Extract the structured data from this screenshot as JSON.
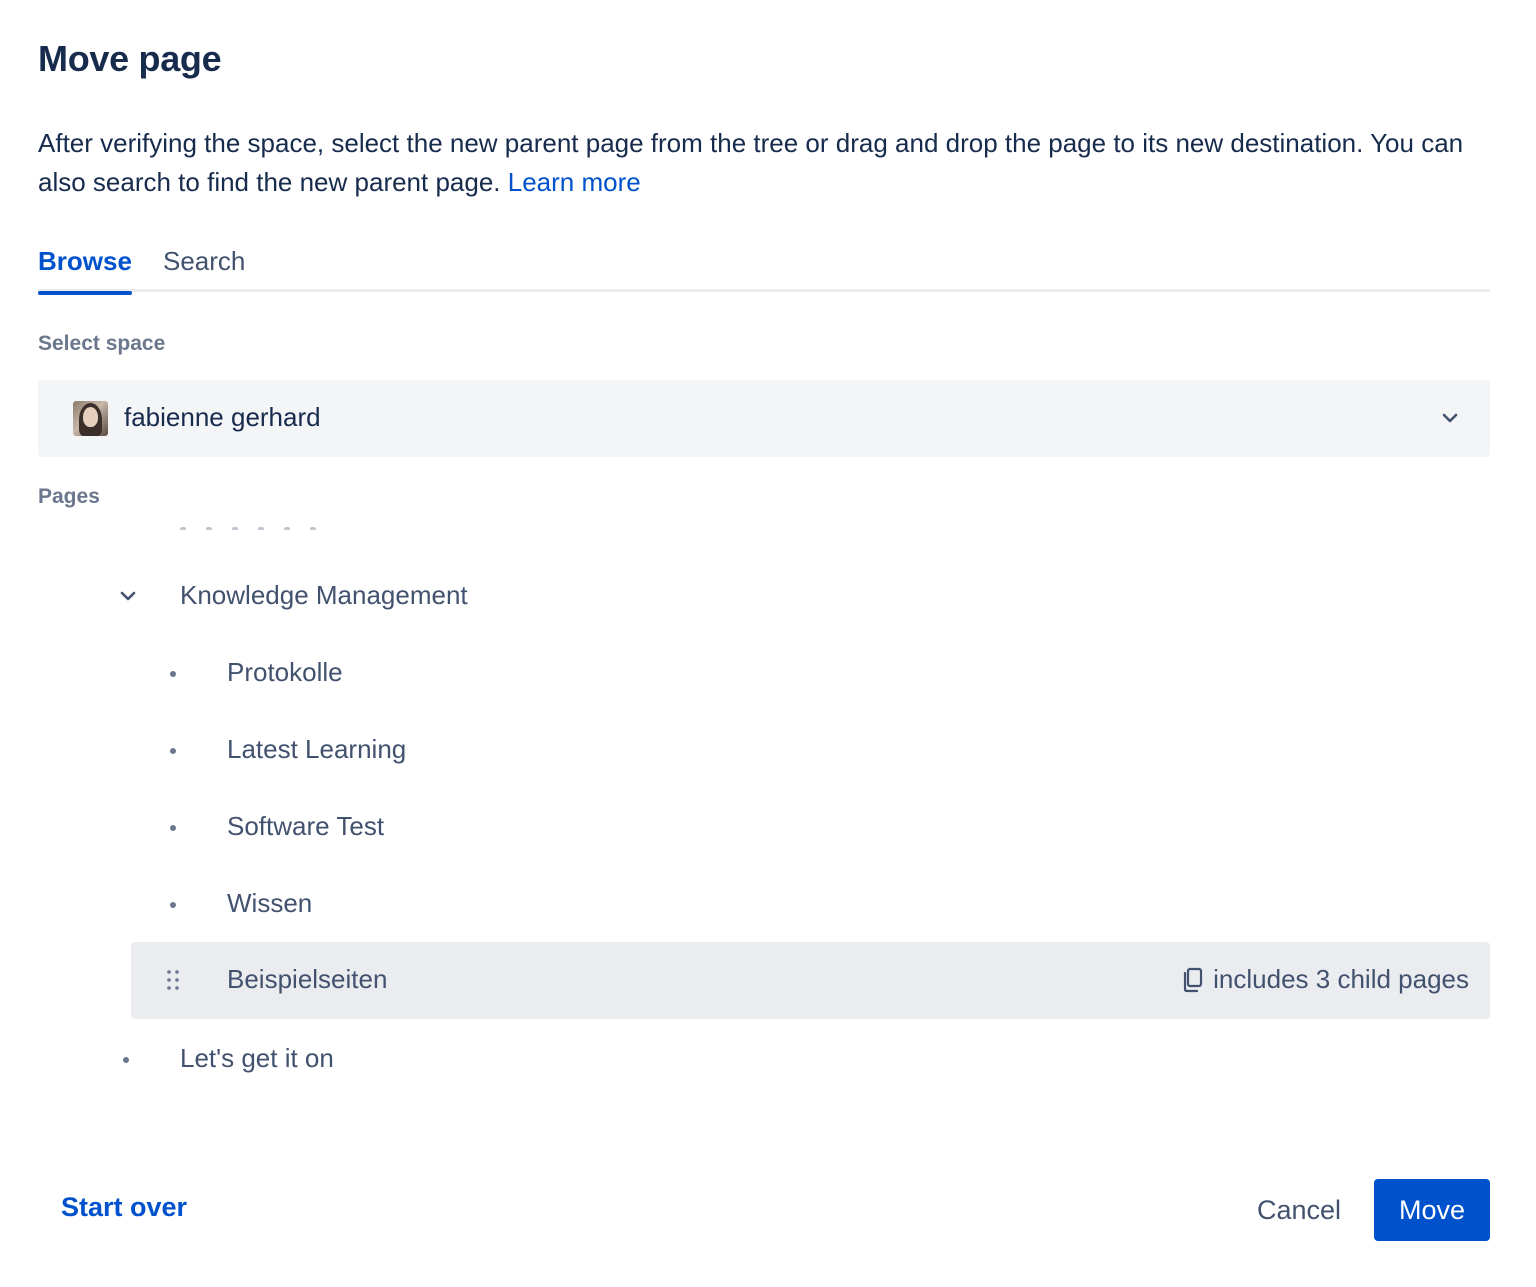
{
  "dialog": {
    "title": "Move page",
    "description": "After verifying the space, select the new parent page from the tree or drag and drop the page to its new destination. You can also search to find the new parent page.",
    "learn_more": "Learn more"
  },
  "tabs": [
    {
      "label": "Browse",
      "active": true
    },
    {
      "label": "Search",
      "active": false
    }
  ],
  "space": {
    "label": "Select space",
    "selected": "fabienne gerhard"
  },
  "pages": {
    "label": "Pages",
    "tree": [
      {
        "label": "Knowledge Management",
        "expanded": true,
        "level": 1
      },
      {
        "label": "Protokolle",
        "level": 2
      },
      {
        "label": "Latest Learning",
        "level": 2
      },
      {
        "label": "Software Test",
        "level": 2
      },
      {
        "label": "Wissen",
        "level": 2
      },
      {
        "label": "Beispielseiten",
        "level": 2,
        "selected": true,
        "child_info": "includes 3 child pages"
      },
      {
        "label": "Let's get it on",
        "level": 1
      }
    ]
  },
  "footer": {
    "start_over": "Start over",
    "cancel": "Cancel",
    "move": "Move"
  },
  "colors": {
    "accent": "#0052cc",
    "text": "#172b4d",
    "subtle_text": "#42526e",
    "selected_row_bg": "#ebecf0",
    "select_bg": "#f4f5f7"
  }
}
